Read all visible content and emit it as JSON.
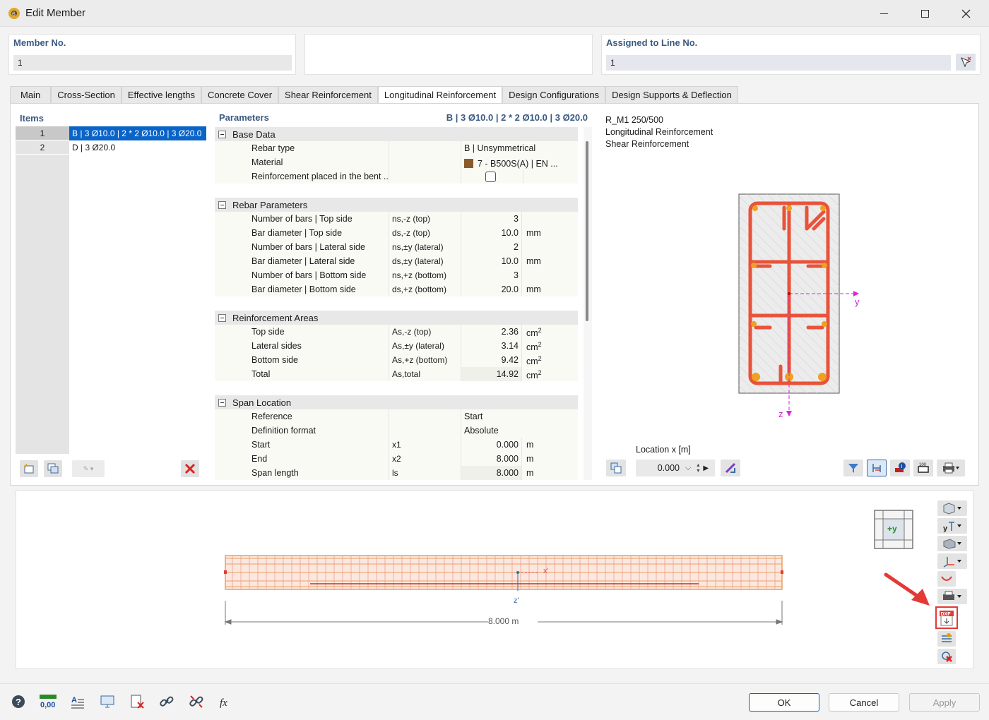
{
  "window": {
    "title": "Edit Member"
  },
  "member_no": {
    "label": "Member No.",
    "value": "1"
  },
  "assigned_line": {
    "label": "Assigned to Line No.",
    "value": "1"
  },
  "tabs": [
    {
      "label": "Main"
    },
    {
      "label": "Cross-Section"
    },
    {
      "label": "Effective lengths"
    },
    {
      "label": "Concrete Cover"
    },
    {
      "label": "Shear Reinforcement"
    },
    {
      "label": "Longitudinal Reinforcement"
    },
    {
      "label": "Design Configurations"
    },
    {
      "label": "Design Supports & Deflection"
    }
  ],
  "items": {
    "header": "Items",
    "rows": [
      {
        "num": "1",
        "text": "B | 3 Ø10.0 | 2 * 2 Ø10.0 | 3 Ø20.0"
      },
      {
        "num": "2",
        "text": "D | 3 Ø20.0"
      }
    ]
  },
  "parameters": {
    "header": "Parameters",
    "summary": "B | 3 Ø10.0 | 2 * 2 Ø10.0 | 3 Ø20.0",
    "groups": [
      {
        "title": "Base Data",
        "rows": [
          {
            "name": "Rebar type",
            "symbol": "",
            "value": "B | Unsymmetrical",
            "unit": ""
          },
          {
            "name": "Material",
            "symbol": "",
            "value": "7 - B500S(A) | EN ...",
            "unit": ""
          },
          {
            "name": "Reinforcement placed in the bent ...",
            "symbol": "",
            "value": "",
            "unit": ""
          }
        ]
      },
      {
        "title": "Rebar Parameters",
        "rows": [
          {
            "name": "Number of bars | Top side",
            "symbol": "ns,-z (top)",
            "value": "3",
            "unit": ""
          },
          {
            "name": "Bar diameter | Top side",
            "symbol": "ds,-z (top)",
            "value": "10.0",
            "unit": "mm"
          },
          {
            "name": "Number of bars | Lateral side",
            "symbol": "ns,±y (lateral)",
            "value": "2",
            "unit": ""
          },
          {
            "name": "Bar diameter | Lateral side",
            "symbol": "ds,±y (lateral)",
            "value": "10.0",
            "unit": "mm"
          },
          {
            "name": "Number of bars | Bottom side",
            "symbol": "ns,+z (bottom)",
            "value": "3",
            "unit": ""
          },
          {
            "name": "Bar diameter | Bottom side",
            "symbol": "ds,+z (bottom)",
            "value": "20.0",
            "unit": "mm"
          }
        ]
      },
      {
        "title": "Reinforcement Areas",
        "rows": [
          {
            "name": "Top side",
            "symbol": "As,-z (top)",
            "value": "2.36",
            "unit": "cm",
            "sup": "2"
          },
          {
            "name": "Lateral sides",
            "symbol": "As,±y (lateral)",
            "value": "3.14",
            "unit": "cm",
            "sup": "2"
          },
          {
            "name": "Bottom side",
            "symbol": "As,+z (bottom)",
            "value": "9.42",
            "unit": "cm",
            "sup": "2"
          },
          {
            "name": "Total",
            "symbol": "As,total",
            "value": "14.92",
            "unit": "cm",
            "sup": "2"
          }
        ]
      },
      {
        "title": "Span Location",
        "rows": [
          {
            "name": "Reference",
            "symbol": "",
            "value": "Start",
            "unit": ""
          },
          {
            "name": "Definition format",
            "symbol": "",
            "value": "Absolute",
            "unit": ""
          },
          {
            "name": "Start",
            "symbol": "x1",
            "value": "0.000",
            "unit": "m"
          },
          {
            "name": "End",
            "symbol": "x2",
            "value": "8.000",
            "unit": "m"
          },
          {
            "name": "Span length",
            "symbol": "ls",
            "value": "8.000",
            "unit": "m"
          }
        ]
      }
    ],
    "material_color": "#8b5a2b"
  },
  "preview": {
    "line1": "R_M1 250/500",
    "line2": "Longitudinal Reinforcement",
    "line3": "Shear Reinforcement",
    "axis_y": "y",
    "axis_z": "z",
    "location_label": "Location x [m]",
    "location_value": "0.000"
  },
  "elevation": {
    "axis_x": "x'",
    "axis_z": "z'",
    "dimension": "8.000 m",
    "nav_label": "+y"
  },
  "buttons": {
    "ok": "OK",
    "cancel": "Cancel",
    "apply": "Apply"
  },
  "colors": {
    "accent": "#0a64c8",
    "rebar": "#e8533a",
    "highlight": "#e53935"
  }
}
